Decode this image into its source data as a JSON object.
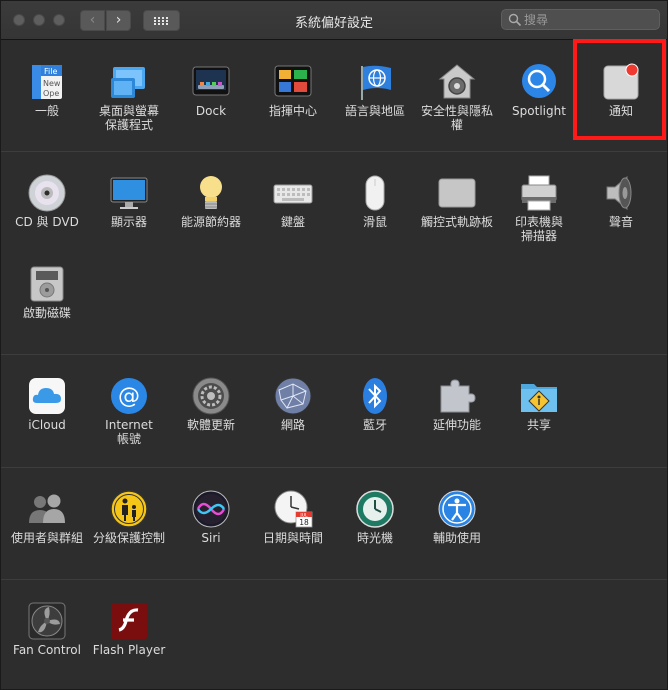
{
  "window": {
    "title": "系統偏好設定"
  },
  "toolbar": {
    "back": "‹",
    "forward": "›"
  },
  "search": {
    "placeholder": "搜尋"
  },
  "sections": [
    {
      "items": [
        {
          "label": "一般"
        },
        {
          "label": "桌面與螢幕\n保護程式"
        },
        {
          "label": "Dock"
        },
        {
          "label": "指揮中心"
        },
        {
          "label": "語言與地區"
        },
        {
          "label": "安全性與隱私權"
        },
        {
          "label": "Spotlight"
        },
        {
          "label": "通知"
        }
      ]
    },
    {
      "items": [
        {
          "label": "CD 與 DVD"
        },
        {
          "label": "顯示器"
        },
        {
          "label": "能源節約器"
        },
        {
          "label": "鍵盤"
        },
        {
          "label": "滑鼠"
        },
        {
          "label": "觸控式軌跡板"
        },
        {
          "label": "印表機與\n掃描器"
        },
        {
          "label": "聲音"
        },
        {
          "label": "啟動磁碟"
        }
      ]
    },
    {
      "items": [
        {
          "label": "iCloud"
        },
        {
          "label": "Internet\n帳號"
        },
        {
          "label": "軟體更新"
        },
        {
          "label": "網路"
        },
        {
          "label": "藍牙"
        },
        {
          "label": "延伸功能"
        },
        {
          "label": "共享"
        }
      ]
    },
    {
      "items": [
        {
          "label": "使用者與群組"
        },
        {
          "label": "分級保護控制"
        },
        {
          "label": "Siri"
        },
        {
          "label": "日期與時間"
        },
        {
          "label": "時光機"
        },
        {
          "label": "輔助使用"
        }
      ]
    },
    {
      "items": [
        {
          "label": "Fan Control"
        },
        {
          "label": "Flash Player"
        }
      ]
    }
  ],
  "icon_text": {
    "general_file": "File",
    "general_new": "New",
    "general_ope": "Ope",
    "calendar_month": "JUL",
    "calendar_day": "18"
  }
}
